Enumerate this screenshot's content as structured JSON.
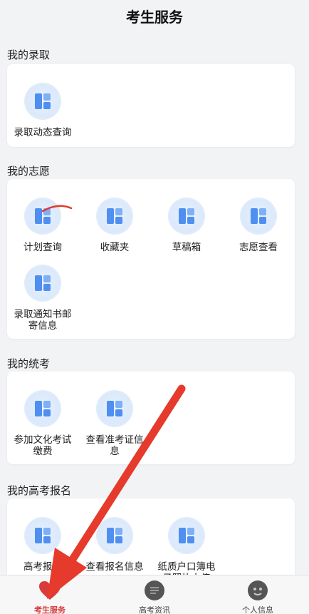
{
  "header": {
    "title": "考生服务"
  },
  "sections": [
    {
      "title": "我的录取",
      "items": [
        {
          "label": "录取动态查询",
          "icon": "grid-icon"
        }
      ]
    },
    {
      "title": "我的志愿",
      "items": [
        {
          "label": "计划查询",
          "icon": "grid-icon"
        },
        {
          "label": "收藏夹",
          "icon": "grid-icon"
        },
        {
          "label": "草稿箱",
          "icon": "grid-icon"
        },
        {
          "label": "志愿查看",
          "icon": "grid-icon"
        },
        {
          "label": "录取通知书邮寄信息",
          "icon": "grid-icon"
        }
      ]
    },
    {
      "title": "我的统考",
      "items": [
        {
          "label": "参加文化考试缴费",
          "icon": "grid-icon"
        },
        {
          "label": "查看准考证信息",
          "icon": "grid-icon"
        }
      ]
    },
    {
      "title": "我的高考报名",
      "items": [
        {
          "label": "高考报名",
          "icon": "grid-icon"
        },
        {
          "label": "查看报名信息",
          "icon": "grid-icon"
        },
        {
          "label": "纸质户口簿电子照片上传",
          "icon": "grid-icon"
        }
      ]
    }
  ],
  "bottom_nav": [
    {
      "label": "考生服务",
      "icon": "heart-icon",
      "active": true
    },
    {
      "label": "高考资讯",
      "icon": "news-icon",
      "active": false
    },
    {
      "label": "个人信息",
      "icon": "user-face-icon",
      "active": false
    }
  ],
  "colors": {
    "accent": "#d93a3a",
    "icon_blue": "#4f8ff0",
    "annotation_red": "#e53a2c"
  }
}
